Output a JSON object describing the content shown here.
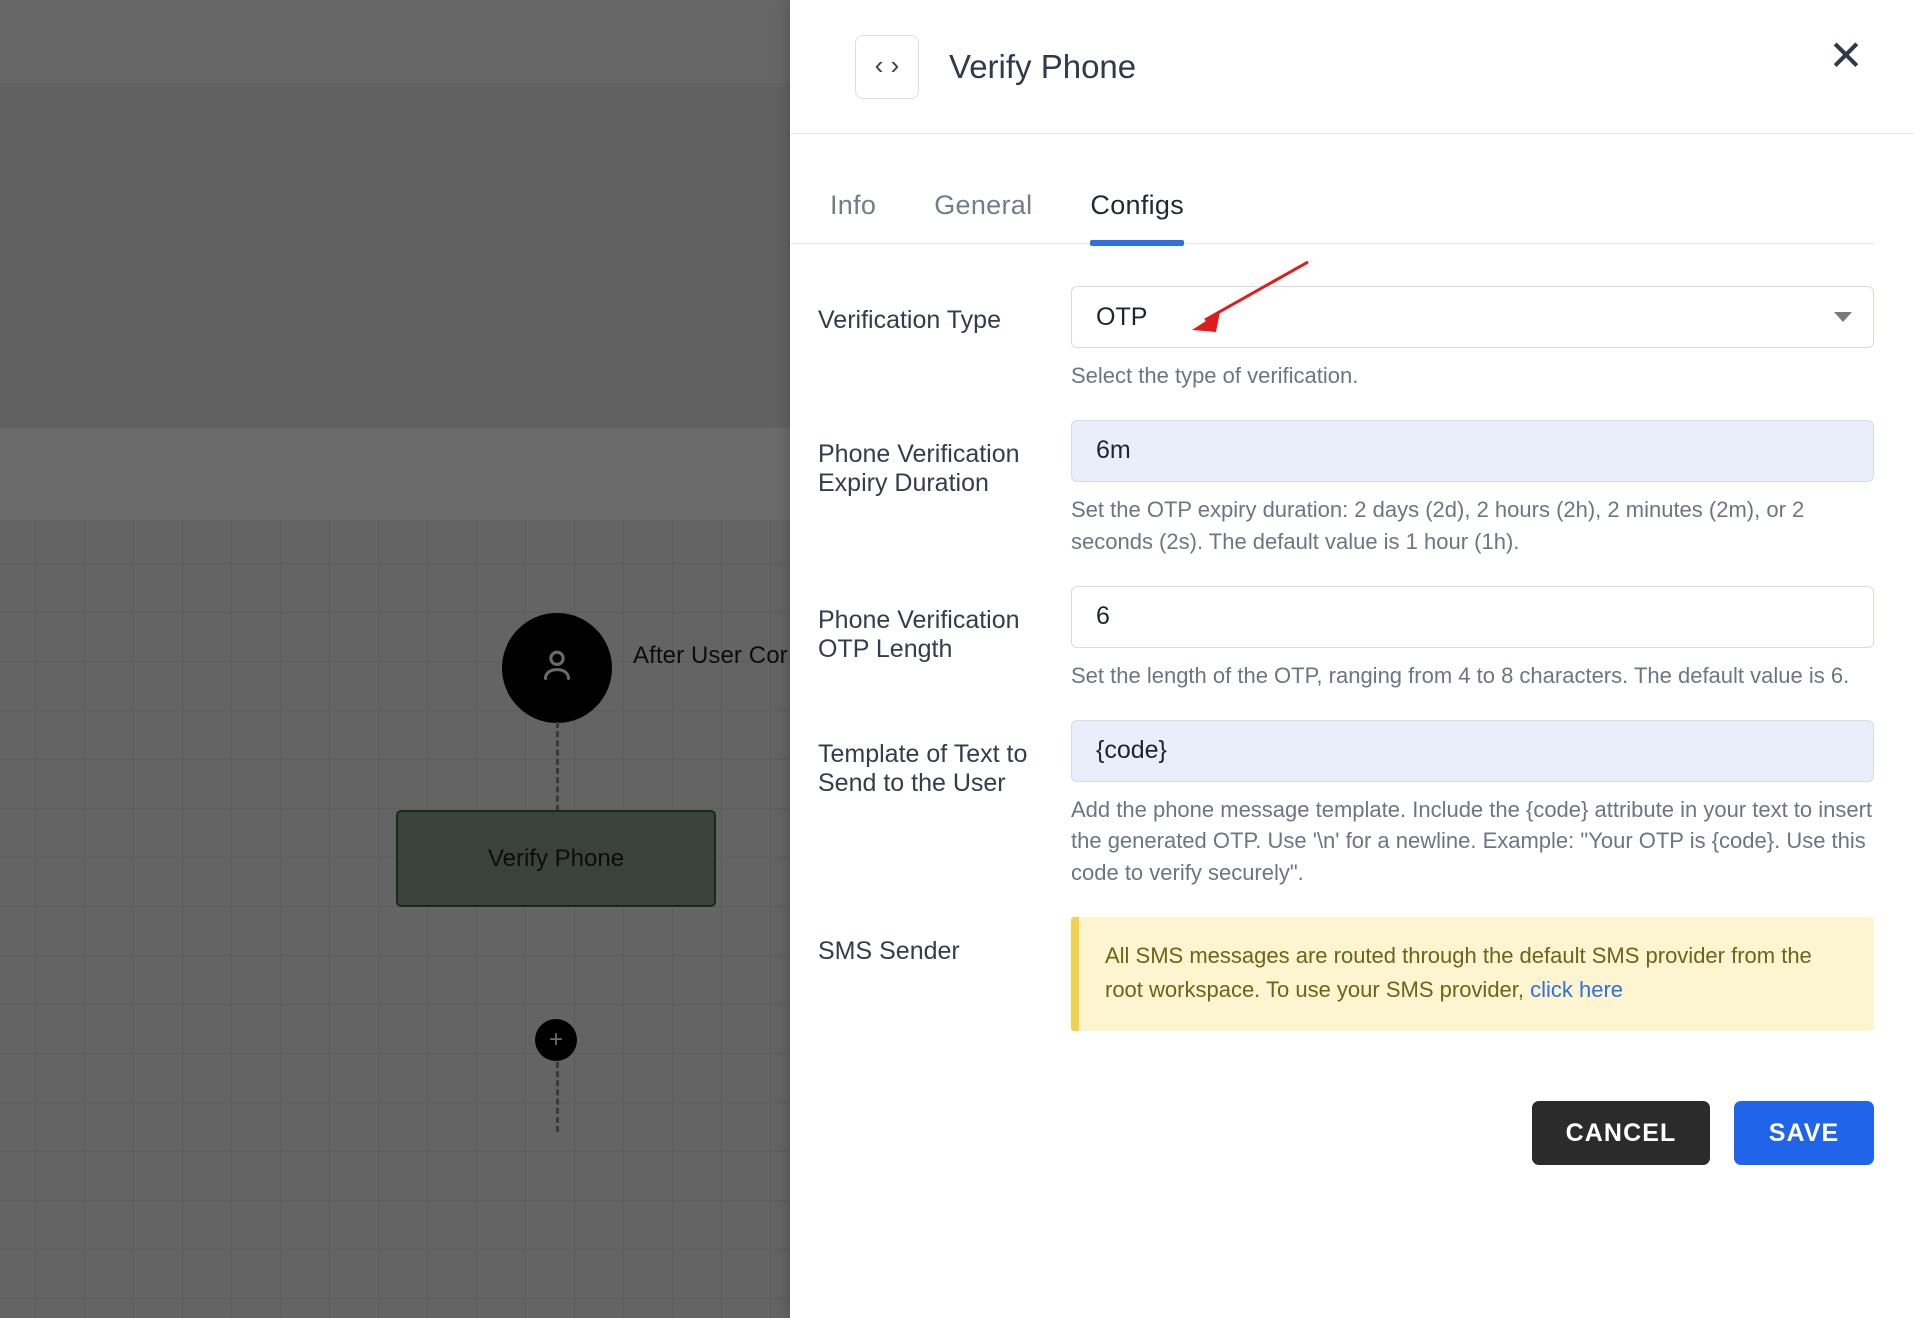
{
  "canvas": {
    "start_node_icon": "person-icon",
    "start_node_label": "After User Cor",
    "node_label": "Verify Phone",
    "add_button_label": "+"
  },
  "drawer": {
    "icon": "code-brackets-icon",
    "icon_glyph": "‹›",
    "title": "Verify Phone",
    "close_label": "✕",
    "tabs": [
      {
        "label": "Info",
        "active": false
      },
      {
        "label": "General",
        "active": false
      },
      {
        "label": "Configs",
        "active": true
      }
    ],
    "accent_color": "#2f6fe4",
    "fields": [
      {
        "label": "Verification Type",
        "type": "select",
        "value": "OTP",
        "helper": "Select the type of verification."
      },
      {
        "label": "Phone Verification Expiry Duration",
        "type": "text",
        "value": "6m",
        "filled": true,
        "helper": "Set the OTP expiry duration: 2 days (2d), 2 hours (2h), 2 minutes (2m), or 2 seconds (2s). The default value is 1 hour (1h)."
      },
      {
        "label": "Phone Verification OTP Length",
        "type": "text",
        "value": "6",
        "filled": false,
        "helper": "Set the length of the OTP, ranging from 4 to 8 characters. The default value is 6."
      },
      {
        "label": "Template of Text to Send to the User",
        "type": "text",
        "value": "{code}",
        "filled": true,
        "helper": "Add the phone message template. Include the {code} attribute in your text to insert the generated OTP. Use '\\n' for a newline. Example: \"Your OTP is {code}. Use this code to verify securely\"."
      }
    ],
    "sms_sender": {
      "label": "SMS Sender",
      "alert_text": "All SMS messages are routed through the default SMS provider from the root workspace. To use your SMS provider, ",
      "alert_link": "click here",
      "alert_bg": "#fdf5cf",
      "alert_border": "#f0d250"
    },
    "buttons": {
      "cancel": "CANCEL",
      "save": "SAVE",
      "cancel_color": "#2b2b2b",
      "save_color": "#2064ea"
    }
  },
  "annotation": {
    "type": "arrow",
    "color": "#e01b1b"
  }
}
